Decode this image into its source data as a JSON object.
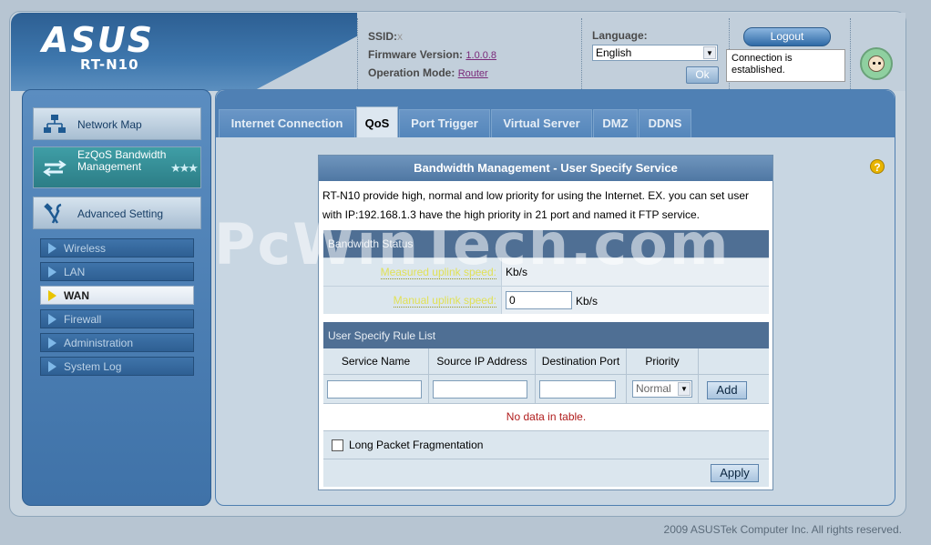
{
  "header": {
    "logo": "ASUS",
    "model": "RT-N10",
    "ssid_label": "SSID:",
    "ssid_value": "",
    "firmware_label": "Firmware Version:",
    "firmware_value": "1.0.0.8",
    "opmode_label": "Operation Mode:",
    "opmode_value": "Router",
    "language_label": "Language:",
    "language_value": "English",
    "ok_label": "Ok",
    "logout_label": "Logout",
    "status_text": "Connection is established."
  },
  "sidebar": {
    "network_map": "Network Map",
    "ezqos": "EzQoS Bandwidth Management",
    "advanced": "Advanced Setting",
    "items": [
      {
        "label": "Wireless"
      },
      {
        "label": "LAN"
      },
      {
        "label": "WAN"
      },
      {
        "label": "Firewall"
      },
      {
        "label": "Administration"
      },
      {
        "label": "System Log"
      }
    ]
  },
  "tabs": [
    {
      "label": "Internet Connection"
    },
    {
      "label": "QoS"
    },
    {
      "label": "Port Trigger"
    },
    {
      "label": "Virtual Server"
    },
    {
      "label": "DMZ"
    },
    {
      "label": "DDNS"
    }
  ],
  "main": {
    "title": "Bandwidth Management - User Specify Service",
    "description": "RT-N10 provide high, normal and low priority for using the Internet. EX. you can set user with IP:192.168.1.3 have the high priority in 21 port and named it FTP service.",
    "bandwidth_status": "Bandwidth Status",
    "measured_label": "Measured uplink speed:",
    "measured_unit": "Kb/s",
    "manual_label": "Manual uplink speed:",
    "manual_value": "0",
    "manual_unit": "Kb/s",
    "rule_list": "User Specify Rule List",
    "columns": [
      "Service Name",
      "Source IP Address",
      "Destination Port",
      "Priority"
    ],
    "priority_value": "Normal",
    "add_label": "Add",
    "no_data": "No data in table.",
    "frag_label": "Long Packet Fragmentation",
    "apply_label": "Apply"
  },
  "footer": "2009 ASUSTek Computer Inc. All rights reserved.",
  "watermark": "PcWinTech.com"
}
